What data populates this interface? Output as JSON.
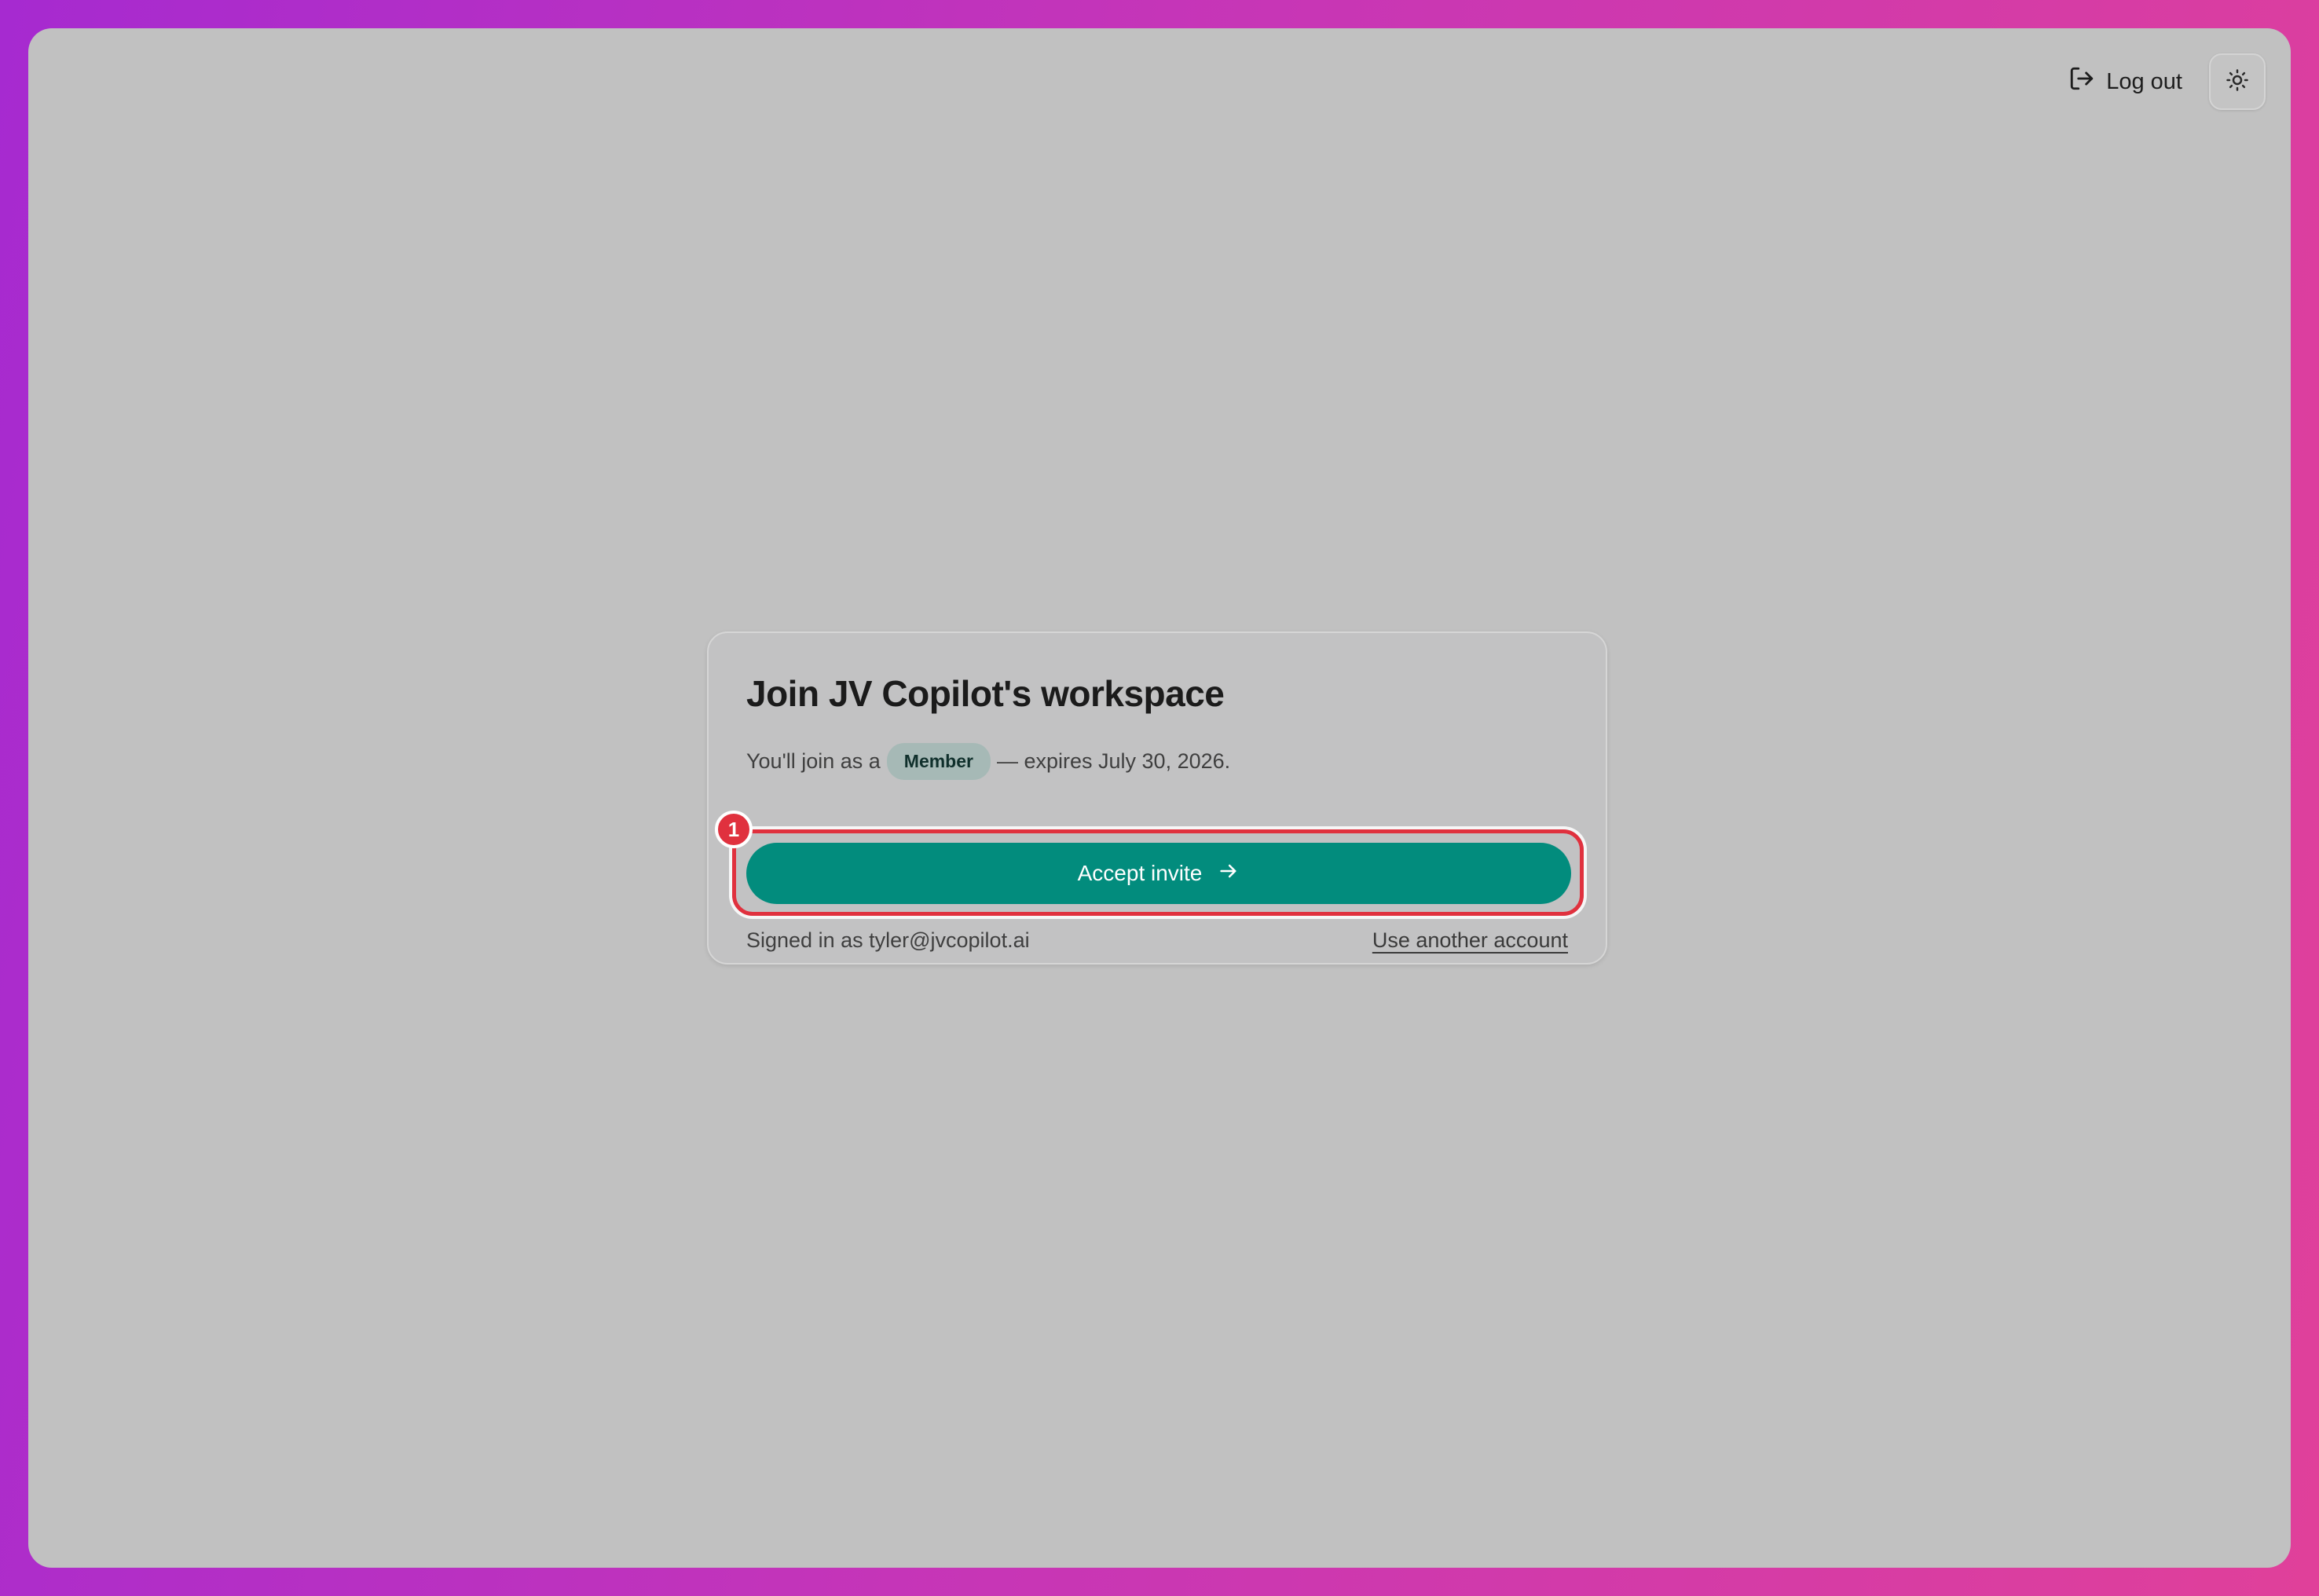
{
  "header": {
    "logout_label": "Log out",
    "logout_icon": "logout-icon",
    "theme_icon": "sun-icon"
  },
  "invite": {
    "title": "Join JV Copilot's workspace",
    "join_prefix": "You'll join as a",
    "role": "Member",
    "expiry_text": "— expires July 30, 2026.",
    "accept_label": "Accept invite",
    "accept_icon": "arrow-right-icon",
    "signed_in_text": "Signed in as tyler@jvcopilot.ai",
    "switch_account_label": "Use another account"
  },
  "annotation": {
    "marker_label": "1"
  },
  "colors": {
    "accent": "#028c7d",
    "highlight": "#e0313e",
    "badge": "#a6b9b6",
    "background": "#c1c1c1"
  }
}
